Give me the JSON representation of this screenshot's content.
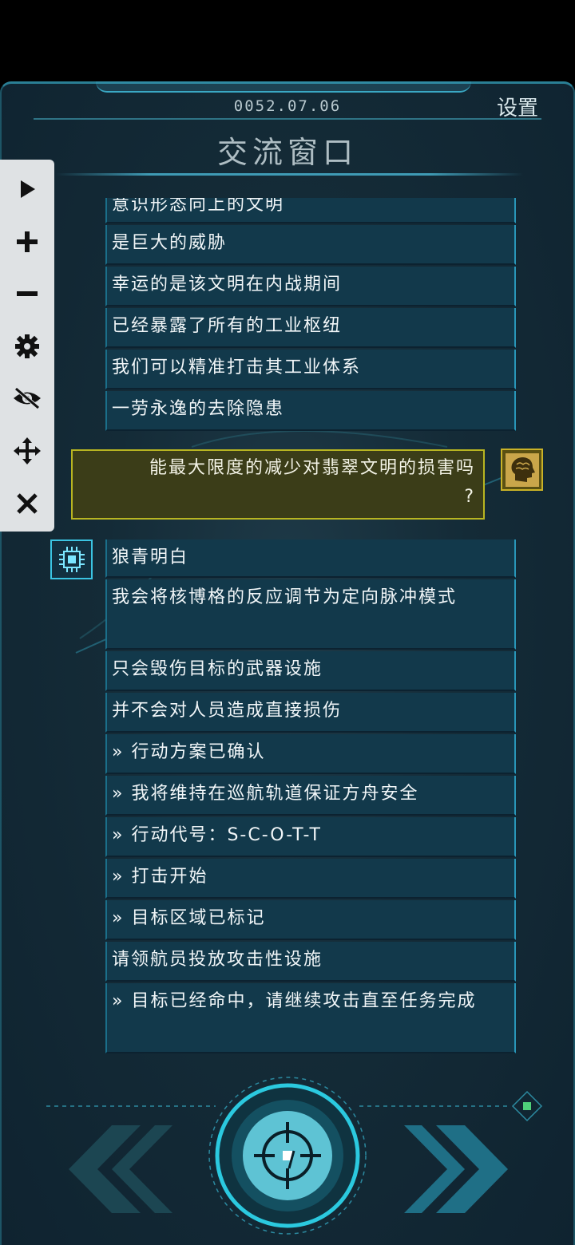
{
  "header": {
    "date": "0052.07.06",
    "settings_label": "设置",
    "title": "交流窗口"
  },
  "messages_before": [
    "意识形态向上的文明",
    "是巨大的威胁",
    "幸运的是该文明在内战期间",
    "已经暴露了所有的工业枢纽",
    "我们可以精准打击其工业体系",
    "一劳永逸的去除隐患"
  ],
  "user_message": {
    "line1": "能最大限度的减少对翡翠文明的损害吗",
    "line2": "?"
  },
  "messages_after": [
    "狼青明白",
    "我会将核博格的反应调节为定向脉冲模式",
    "只会毁伤目标的武器设施",
    "并不会对人员造成直接损伤",
    "» 行动方案已确认",
    "» 我将维持在巡航轨道保证方舟安全",
    "» 行动代号：S-C-O-T-T",
    "» 打击开始",
    "» 目标区域已标记",
    "请领航员投放攻击性设施",
    "» 目标已经命中，请继续攻击直至任务完成"
  ],
  "floating_toolbar": {
    "icons": [
      "play-icon",
      "plus-icon",
      "minus-icon",
      "gear-icon",
      "eye-off-icon",
      "move-icon",
      "close-icon"
    ]
  },
  "bottom_controls": {
    "left": "chevrons-left-icon",
    "center": "crosshair-icon",
    "right": "chevrons-right-icon"
  },
  "colors": {
    "panel_bg": "#142b37",
    "message_bg": "#12394b",
    "accent_cyan": "#3bc4e2",
    "user_bubble_bg": "#3b3d18",
    "user_bubble_border": "#b8b521"
  }
}
